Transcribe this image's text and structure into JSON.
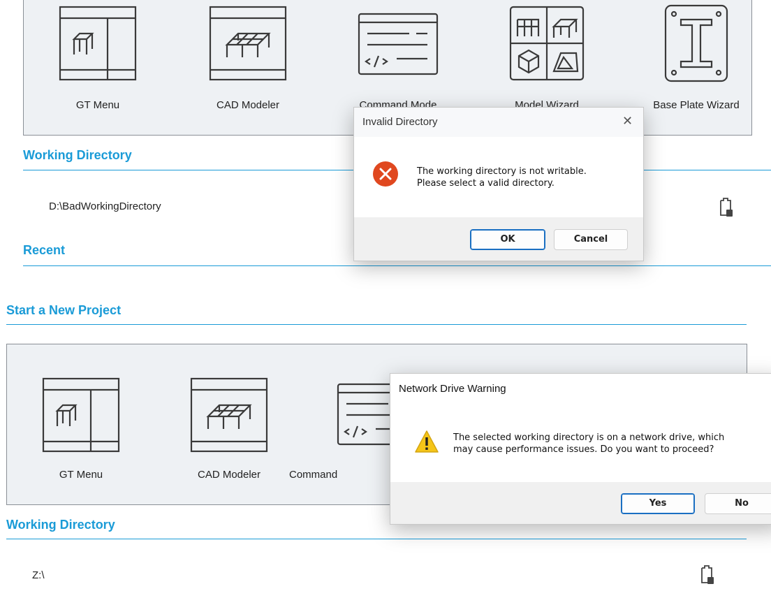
{
  "top": {
    "tiles": [
      {
        "label": "GT Menu",
        "icon": "gt-menu-icon"
      },
      {
        "label": "CAD Modeler",
        "icon": "cad-modeler-icon"
      },
      {
        "label": "Command Mode",
        "icon": "command-mode-icon"
      },
      {
        "label": "Model Wizard",
        "icon": "model-wizard-icon"
      },
      {
        "label": "Base Plate Wizard",
        "icon": "base-plate-wizard-icon"
      }
    ],
    "working_directory_title": "Working Directory",
    "working_directory_value": "D:\\BadWorkingDirectory",
    "recent_title": "Recent"
  },
  "invalid_dialog": {
    "title": "Invalid Directory",
    "close": "✕",
    "message_line1": "The working directory is not writable.",
    "message_line2": "Please select a valid directory.",
    "ok_label": "OK",
    "cancel_label": "Cancel",
    "icon": "error-icon"
  },
  "bottom": {
    "start_title": "Start a New Project",
    "tiles": [
      {
        "label": "GT Menu",
        "icon": "gt-menu-icon"
      },
      {
        "label": "CAD Modeler",
        "icon": "cad-modeler-icon"
      },
      {
        "label": "Command",
        "icon": "command-mode-icon"
      }
    ],
    "working_directory_title": "Working Directory",
    "working_directory_value": "Z:\\"
  },
  "network_dialog": {
    "title": "Network Drive Warning",
    "message_line1": "The selected working directory is on a network drive, which",
    "message_line2": "may cause performance issues. Do you want to proceed?",
    "yes_label": "Yes",
    "no_label": "No",
    "icon": "warning-icon"
  },
  "colors": {
    "accent": "#1a9bd7",
    "panel_bg": "#eef1f4",
    "error_red": "#e0481f",
    "warning_yellow": "#f5c518"
  }
}
